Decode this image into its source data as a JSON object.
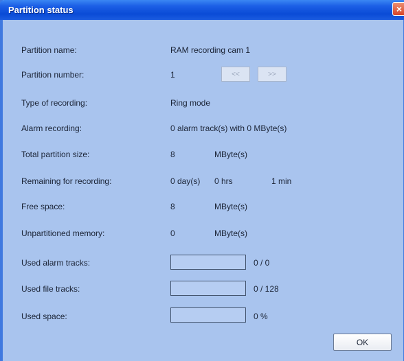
{
  "window": {
    "title": "Partition status",
    "close_glyph": "×"
  },
  "fields": {
    "partition_name": {
      "label": "Partition name:",
      "value": "RAM recording cam 1"
    },
    "partition_number": {
      "label": "Partition number:",
      "value": "1",
      "prev_label": "<<",
      "next_label": ">>"
    },
    "type_of_recording": {
      "label": "Type of recording:",
      "value": "Ring mode"
    },
    "alarm_recording": {
      "label": "Alarm recording:",
      "value": "0 alarm track(s) with 0 MByte(s)"
    },
    "total_partition_size": {
      "label": "Total partition size:",
      "value": "8",
      "unit": "MByte(s)"
    },
    "remaining": {
      "label": "Remaining for recording:",
      "days": "0 day(s)",
      "hrs": "0 hrs",
      "min": "1 min"
    },
    "free_space": {
      "label": "Free space:",
      "value": "8",
      "unit": "MByte(s)"
    },
    "unpartitioned": {
      "label": "Unpartitioned memory:",
      "value": "0",
      "unit": "MByte(s)"
    }
  },
  "usage": {
    "alarm_tracks": {
      "label": "Used alarm tracks:",
      "text": "0 / 0",
      "fraction": 0
    },
    "file_tracks": {
      "label": "Used file tracks:",
      "text": "0 / 128",
      "fraction": 0
    },
    "space": {
      "label": "Used space:",
      "text": "0 %",
      "fraction": 0
    }
  },
  "buttons": {
    "ok_label": "OK"
  },
  "colors": {
    "dialog_bg": "#a9c4ee",
    "titlebar": "#0a4bd6",
    "close": "#d8452a"
  }
}
